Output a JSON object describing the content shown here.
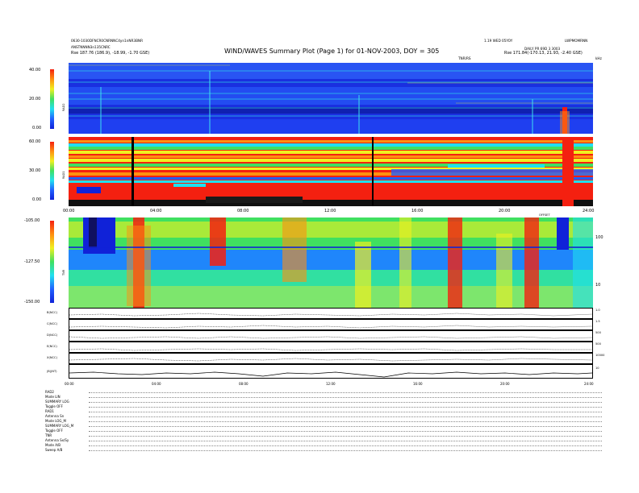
{
  "header": {
    "title": "WIND/WAVES Summary Plot (Page 1) for 01-NOV-2003, DOY = 305",
    "left_line1": "0630-1030DFNCR0CNRNNC4yn1nNR3BNR",
    "left_line2": "ANSTNNNN3n135CNRC",
    "left_line3": "Rse   187.76 (186.9), -18.99, -1.70 GSE)",
    "right_line1": "1.19 WED 05YOY",
    "right_line2": "LWPMOMRNN",
    "right_line3": "DAILY PR 69D 3 3003",
    "right_line4": "Rse   171.84(-170.13, 21.93, -2.40 GSE)",
    "tnr_label": "TNR/RS",
    "khz_label": "kHz"
  },
  "time_axis": {
    "ticks": [
      "00:00",
      "04:00",
      "08:00",
      "12:00",
      "16:00",
      "20:00",
      "24:00"
    ],
    "offset_label": "OFFSET"
  },
  "panels": {
    "rad2": {
      "label": "RAD2",
      "cbar_ticks": [
        "40.00",
        "20.00",
        "0.00"
      ]
    },
    "rad1": {
      "label": "RAD1",
      "cbar_ticks": [
        "60.00",
        "30.00",
        "0.00"
      ]
    },
    "tnr": {
      "label": "TNR",
      "cbar_ticks": [
        "-105.00",
        "-127.50",
        "-150.00"
      ],
      "right_ticks": [
        "100",
        "10"
      ]
    }
  },
  "line_panels": [
    {
      "label": "B(NCC)",
      "right_ticks": [
        "1.0",
        "0.0"
      ]
    },
    {
      "label": "C(NCC)",
      "right_ticks": [
        "1.5",
        "0.0"
      ]
    },
    {
      "label": "D(NCC)",
      "right_ticks": [
        "500",
        "0.0"
      ]
    },
    {
      "label": "E(NCC)",
      "right_ticks": [
        "500",
        "0.0"
      ]
    },
    {
      "label": "X(NCC)",
      "right_ticks": [
        "10000",
        "0"
      ]
    },
    {
      "label": "|B|(NT)",
      "right_ticks": [
        "10",
        "0"
      ]
    }
  ],
  "info": [
    {
      "k": "RAD2",
      "v": ""
    },
    {
      "k": "Mode",
      "v": "LIN"
    },
    {
      "k": "SUMMARY",
      "v": "LOG"
    },
    {
      "k": "Toggle",
      "v": "OFF"
    },
    {
      "k": "RAD1",
      "v": ""
    },
    {
      "k": "Antenna",
      "v": "Sn"
    },
    {
      "k": "Mode",
      "v": "LOG_M"
    },
    {
      "k": "SUMMARY",
      "v": "LOG_M"
    },
    {
      "k": "Toggle",
      "v": "OFF"
    },
    {
      "k": "TNR",
      "v": ""
    },
    {
      "k": "Antenna",
      "v": "Sx/Sy"
    },
    {
      "k": "Mode",
      "v": "A/B"
    },
    {
      "k": "Sweep",
      "v": "A/B"
    }
  ],
  "chart_data": {
    "type": "heatmap",
    "title": "WIND/WAVES Summary Plot (Page 1) for 01-NOV-2003, DOY = 305",
    "x_range_hours": [
      0,
      24
    ],
    "panels": [
      "RAD2",
      "RAD1",
      "TNR"
    ],
    "line_series": [
      "B(NCC)",
      "C(NCC)",
      "D(NCC)",
      "E(NCC)",
      "X(NCC)",
      "|B|(NT)"
    ]
  },
  "colors": {
    "deep_blue": "#1022d8",
    "blue": "#2060ff",
    "cyan": "#20e0f0",
    "green": "#40e060",
    "yellow": "#f0f020",
    "orange": "#ff9010",
    "red": "#f42010"
  }
}
